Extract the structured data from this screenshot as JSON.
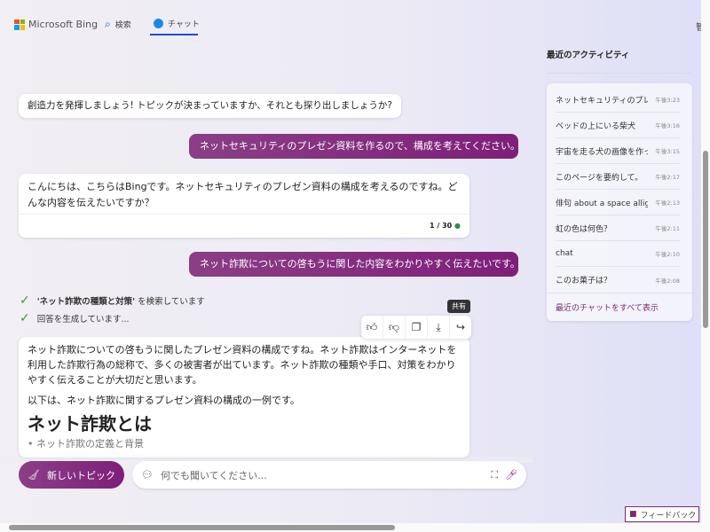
{
  "header": {
    "brand": "Microsoft Bing",
    "tabs": [
      {
        "label": "検索"
      },
      {
        "label": "チャット"
      }
    ],
    "cut_text": "智宣"
  },
  "chat": {
    "greeting": "創造力を発揮しましょう! トピックが決まっていますか、それとも探り出しましょうか?",
    "user1": "ネットセキュリティのプレゼン資料を作るので、構成を考えてください。",
    "bot1": "こんにちは、こちらはBingです。ネットセキュリティのプレゼン資料の構成を考えるのですね。どんな内容を伝えたいですか？",
    "counter": "1 / 30",
    "user2": "ネット詐欺についての啓もうに関した内容をわかりやすく伝えたいです。",
    "status1_query": "'ネット詐欺の種類と対策'",
    "status1_rest": " を検索しています",
    "status2": "回答を生成しています...",
    "tooltip": "共有",
    "answer_p1": "ネット詐欺についての啓もうに関したプレゼン資料の構成ですね。ネット詐欺はインターネットを利用した詐欺行為の総称で、多くの被害者が出ています。ネット詐欺の種類や手口、対策をわかりやすく伝えることが大切だと思います。",
    "answer_p2": "以下は、ネット詐欺に関するプレゼン資料の構成の一例です。",
    "answer_h": "ネット詐欺とは",
    "answer_li": "ネット詐欺の定義と背景"
  },
  "composer": {
    "new_topic": "新しいトピック",
    "placeholder": "何でも聞いてください..."
  },
  "sidebar": {
    "title": "最近のアクティビティ",
    "items": [
      {
        "title": "ネットセキュリティのプレ",
        "time": "午後3:23"
      },
      {
        "title": "ベッドの上にいる柴犬",
        "time": "午後3:16"
      },
      {
        "title": "宇宙を走る犬の画像を作って",
        "time": "午後3:15"
      },
      {
        "title": "このページを要約して。",
        "time": "午後2:17"
      },
      {
        "title": "俳句 about a space alligator",
        "time": "午後2:13"
      },
      {
        "title": "虹の色は何色？",
        "time": "午後2:11"
      },
      {
        "title": "chat",
        "time": "午後2:10"
      },
      {
        "title": "このお菓子は？",
        "time": "午後2:08"
      }
    ],
    "see_all": "最近のチャットをすべて表示"
  },
  "feedback": "フィードバック",
  "colors": {
    "accent": "#7e1f7a",
    "tab_underline": "#1a4ed8",
    "check": "#2e9d3a"
  }
}
